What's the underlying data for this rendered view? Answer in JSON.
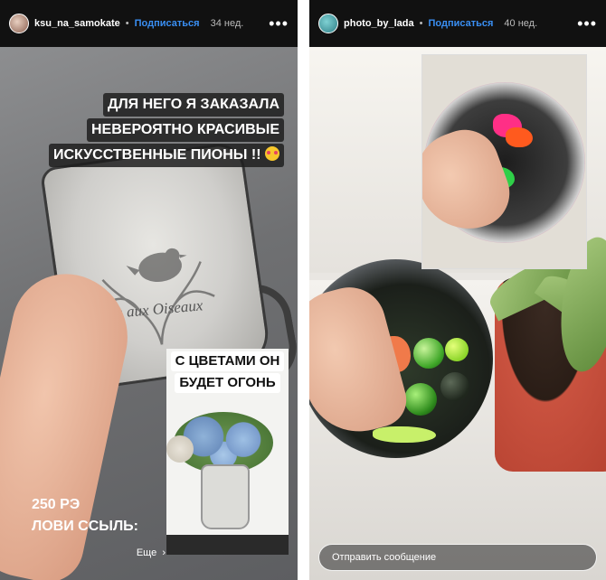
{
  "left_story": {
    "username": "ksu_na_samokate",
    "follow_label": "Подписаться",
    "separator": "•",
    "time_ago": "34 нед.",
    "more_icon": "more-dots-icon",
    "caption_top": [
      "ДЛЯ НЕГО Я ЗАКАЗАЛА",
      "НЕВЕРОЯТНО КРАСИВЫЕ",
      "ИСКУССТВЕННЫЕ ПИОНЫ !!"
    ],
    "caption_emoji": "heart-eyes-emoji",
    "jug_print_text": "Jardin aux Oiseaux",
    "inset_caption": [
      "С ЦВЕТАМИ ОН",
      "БУДЕТ ОГОНЬ"
    ],
    "price_caption": [
      "250 РЭ",
      "ЛОВИ ССЫЛЬ:"
    ],
    "see_more_label": "Еще",
    "see_more_icon": "chevron-right-icon"
  },
  "right_story": {
    "username": "photo_by_lada",
    "follow_label": "Подписаться",
    "separator": "•",
    "time_ago": "40 нед.",
    "more_icon": "more-dots-icon",
    "reply_placeholder": "Отправить сообщение"
  },
  "colors": {
    "header_bg": "#111111",
    "follow_blue": "#3a8ff3",
    "caption_bg": "#1e1e1e"
  }
}
